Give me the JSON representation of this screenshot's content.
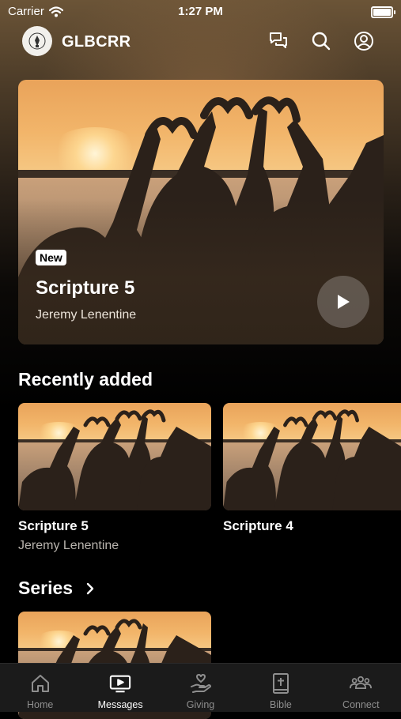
{
  "status_bar": {
    "carrier": "Carrier",
    "time": "1:27 PM"
  },
  "header": {
    "app_name": "GLBCRR",
    "icons": [
      "chat-icon",
      "search-icon",
      "profile-icon"
    ]
  },
  "featured": {
    "badge": "New",
    "title": "Scripture 5",
    "author": "Jeremy Lenentine"
  },
  "recently_added": {
    "heading": "Recently added",
    "items": [
      {
        "title": "Scripture 5",
        "author": "Jeremy Lenentine"
      },
      {
        "title": "Scripture 4",
        "author": ""
      }
    ]
  },
  "series": {
    "heading": "Series"
  },
  "tab_bar": {
    "tabs": [
      {
        "label": "Home",
        "icon": "home-icon",
        "active": false
      },
      {
        "label": "Messages",
        "icon": "tv-play-icon",
        "active": true
      },
      {
        "label": "Giving",
        "icon": "giving-hand-icon",
        "active": false
      },
      {
        "label": "Bible",
        "icon": "bible-icon",
        "active": false
      },
      {
        "label": "Connect",
        "icon": "people-icon",
        "active": false
      }
    ]
  },
  "colors": {
    "background": "#000000",
    "tab_bar": "#1b1b1b",
    "inactive_tab": "#8f8f8f"
  }
}
